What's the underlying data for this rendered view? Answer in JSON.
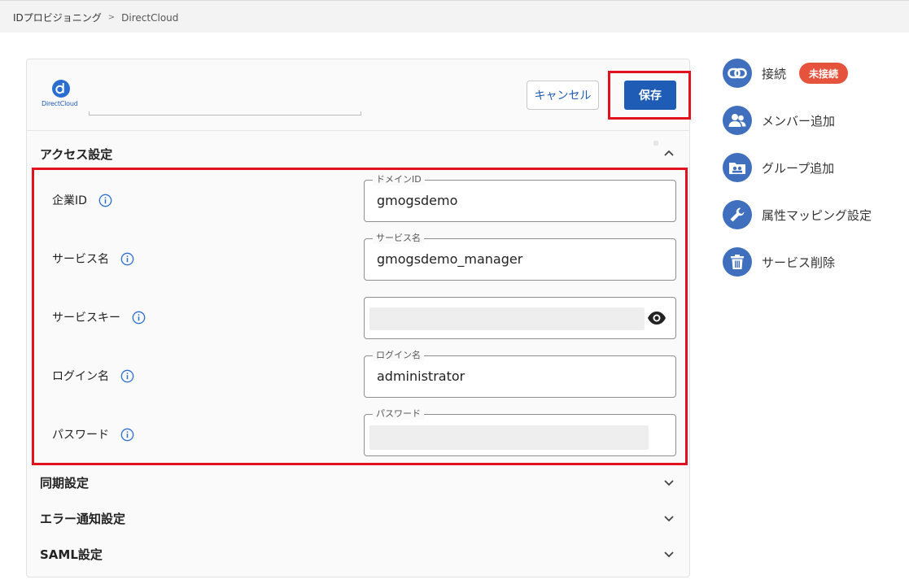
{
  "breadcrumb": {
    "parent": "IDプロビジョニング",
    "separator": ">",
    "current": "DirectCloud"
  },
  "header": {
    "logo_text": "DirectCloud",
    "cancel_label": "キャンセル",
    "save_label": "保存"
  },
  "sections": {
    "access": "アクセス設定",
    "sync": "同期設定",
    "error_notify": "エラー通知設定",
    "saml": "SAML設定"
  },
  "fields": {
    "company_id": {
      "label": "企業ID",
      "legend": "ドメインID",
      "value": "gmogsdemo"
    },
    "service_name": {
      "label": "サービス名",
      "legend": "サービス名",
      "value": "gmogsdemo_manager"
    },
    "service_key": {
      "label": "サービスキー"
    },
    "login_name": {
      "label": "ログイン名",
      "legend": "ログイン名",
      "value": "administrator"
    },
    "password": {
      "label": "パスワード",
      "legend": "パスワード"
    }
  },
  "sidebar": {
    "connect": {
      "label": "接続",
      "badge": "未接続"
    },
    "add_member": {
      "label": "メンバー追加"
    },
    "add_group": {
      "label": "グループ追加"
    },
    "attr_mapping": {
      "label": "属性マッピング設定"
    },
    "delete_service": {
      "label": "サービス削除"
    }
  },
  "colors": {
    "accent": "#1e5cb6",
    "icon_circle": "#3f6fbd",
    "highlight": "#e1121e",
    "badge": "#e5533d"
  },
  "icons": {
    "connect": "link-icon",
    "add_member": "people-icon",
    "add_group": "group-folder-icon",
    "attr_mapping": "wrench-icon",
    "delete_service": "trash-icon",
    "visibility": "eye-icon",
    "info": "info-icon"
  }
}
